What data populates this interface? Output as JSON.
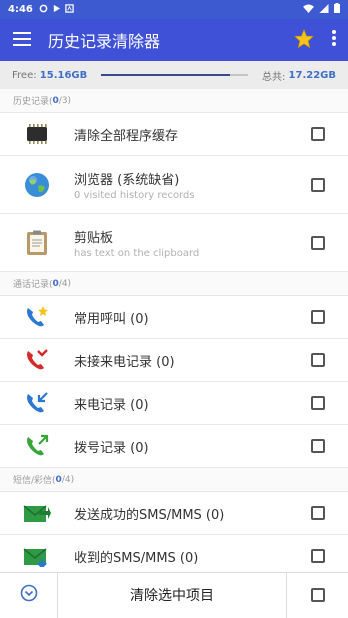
{
  "status": {
    "time": "4:46",
    "left_icons": [
      "settings-icon",
      "play-icon",
      "app-icon"
    ],
    "right_icons": [
      "wifi-icon",
      "signal-icon",
      "battery-icon"
    ]
  },
  "toolbar": {
    "title": "历史记录清除器"
  },
  "storage": {
    "free_label": "Free:",
    "free_value": "15.16GB",
    "total_label": "总共:",
    "total_value": "17.22GB",
    "used_fraction": 0.88
  },
  "sections": {
    "history": {
      "label": "历史记录(",
      "count": "0",
      "total": "/3)"
    },
    "calls": {
      "label": "通话记录(",
      "count": "0",
      "total": "/4)"
    },
    "sms": {
      "label": "短信/彩信(",
      "count": "0",
      "total": "/4)"
    }
  },
  "history_items": [
    {
      "title": "清除全部程序缓存",
      "subtitle": "",
      "icon": "chip-icon"
    },
    {
      "title": "浏览器 (系统缺省)",
      "subtitle": "0 visited history records",
      "icon": "globe-icon"
    },
    {
      "title": "剪贴板",
      "subtitle": "has text on the clipboard",
      "icon": "clipboard-icon"
    }
  ],
  "call_items": [
    {
      "title": "常用呼叫 (0)",
      "icon": "favorite-call-icon"
    },
    {
      "title": "未接来电记录 (0)",
      "icon": "missed-call-icon"
    },
    {
      "title": "来电记录 (0)",
      "icon": "incoming-call-icon"
    },
    {
      "title": "拨号记录 (0)",
      "icon": "outgoing-call-icon"
    }
  ],
  "sms_items": [
    {
      "title": "发送成功的SMS/MMS (0)",
      "icon": "sent-sms-icon"
    },
    {
      "title": "收到的SMS/MMS (0)",
      "icon": "received-sms-icon"
    }
  ],
  "bottom": {
    "action_label": "清除选中项目"
  },
  "colors": {
    "toolbar": "#3f51d6",
    "statusbar": "#3d5ad0",
    "accent": "#3f6fc7"
  }
}
